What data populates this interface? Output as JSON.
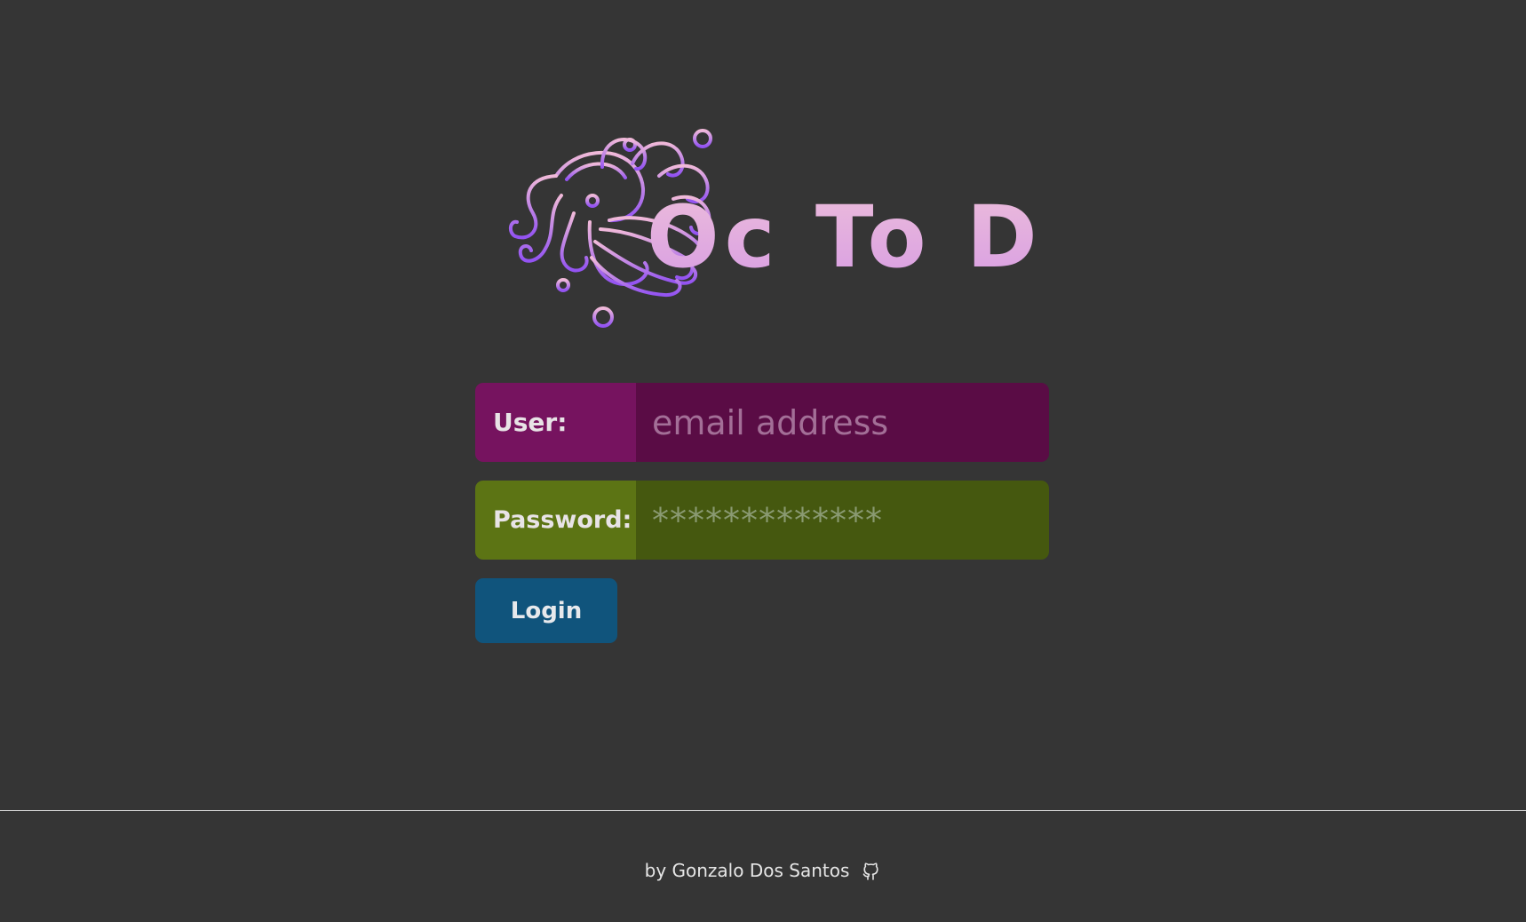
{
  "logo": {
    "text": "Oc To Do",
    "icon": "octopus-icon",
    "gradient_top": "#e9b3d8",
    "gradient_bottom": "#9b5ff0"
  },
  "login_form": {
    "user_label": "User:",
    "user_placeholder": "email address",
    "password_label": "Password:",
    "password_placeholder": "*************",
    "login_label": "Login"
  },
  "colors": {
    "background": "#353535",
    "user_accent": "#76135f",
    "password_accent": "#5c7414",
    "login_button": "#10547c"
  },
  "footer": {
    "credit": "by Gonzalo Dos Santos",
    "icon": "github-icon"
  }
}
